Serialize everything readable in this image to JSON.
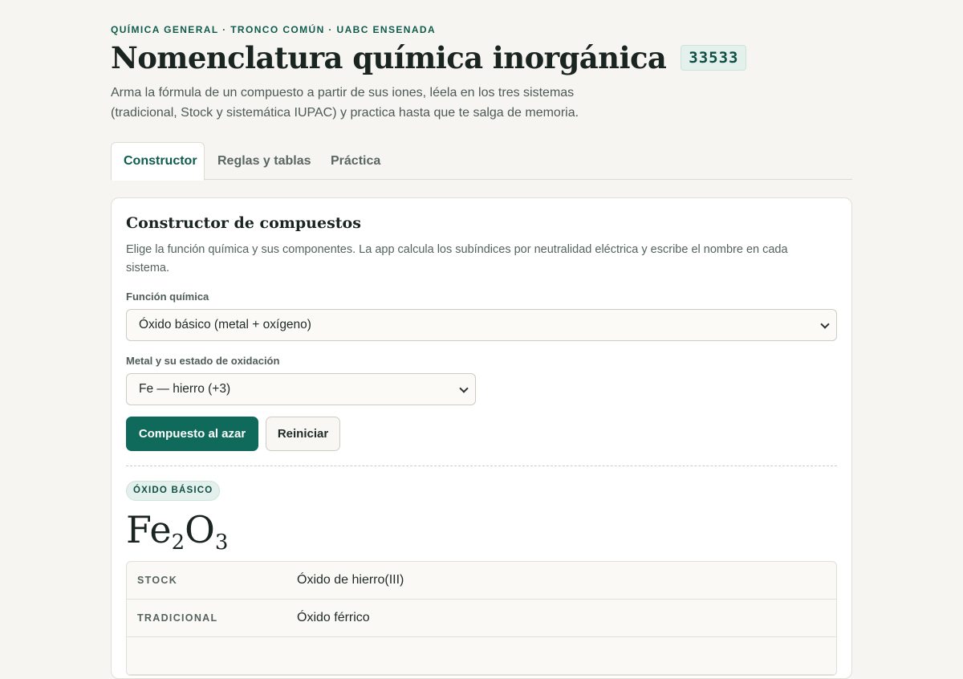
{
  "header": {
    "eyebrow": "QUÍMICA GENERAL · TRONCO COMÚN · UABC ENSENADA",
    "title": "Nomenclatura química inorgánica",
    "code": "33533",
    "intro": "Arma la fórmula de un compuesto a partir de sus iones, léela en los tres sistemas (tradicional, Stock y sistemática IUPAC) y practica hasta que te salga de memoria."
  },
  "tabs": [
    {
      "label": "Constructor",
      "active": true
    },
    {
      "label": "Reglas y tablas",
      "active": false
    },
    {
      "label": "Práctica",
      "active": false
    }
  ],
  "builder": {
    "title": "Constructor de compuestos",
    "description": "Elige la función química y sus componentes. La app calcula los subíndices por neutralidad eléctrica y escribe el nombre en cada sistema.",
    "function_label": "Función química",
    "function_value": "Óxido básico (metal + oxígeno)",
    "metal_label": "Metal y su estado de oxidación",
    "metal_value": "Fe — hierro (+3)",
    "random_button": "Compuesto al azar",
    "reset_button": "Reiniciar"
  },
  "result": {
    "type_badge": "ÓXIDO BÁSICO",
    "formula": {
      "el1": "Fe",
      "sub1": "2",
      "el2": "O",
      "sub2": "3"
    },
    "names": [
      {
        "system": "STOCK",
        "name": "Óxido de hierro(III)"
      },
      {
        "system": "TRADICIONAL",
        "name": "Óxido férrico"
      }
    ]
  },
  "colors": {
    "accent": "#0f6a5b",
    "background": "#f6f5f1",
    "badge_bg": "#e3f0ec"
  }
}
